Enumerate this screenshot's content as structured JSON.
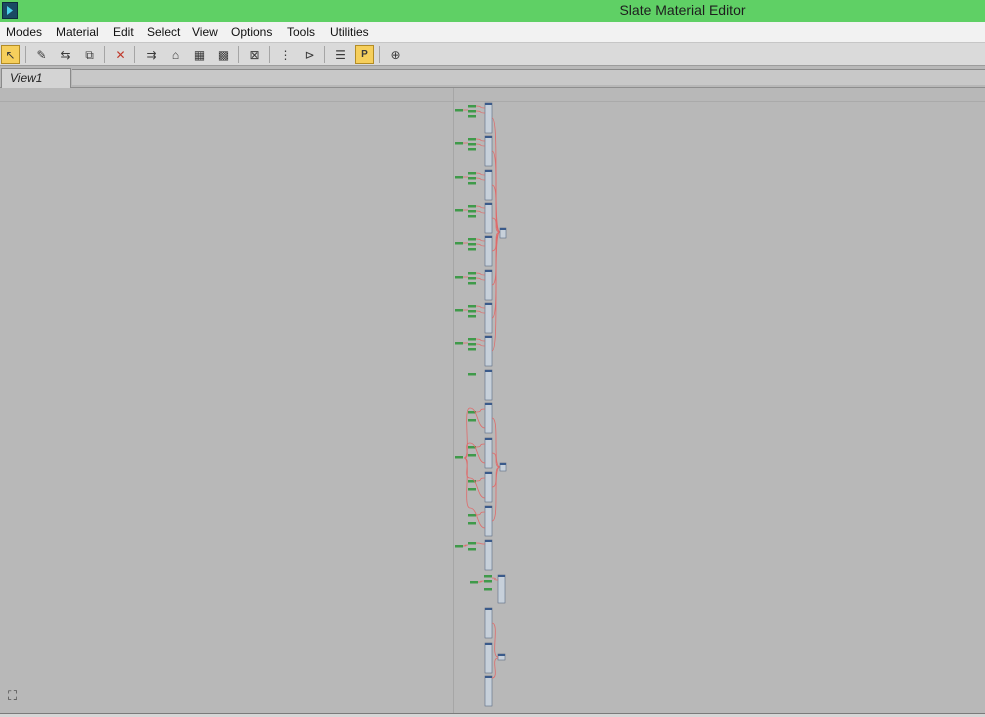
{
  "window": {
    "title": "Slate Material Editor"
  },
  "menubar": {
    "items": [
      "Modes",
      "Material",
      "Edit",
      "Select",
      "View",
      "Options",
      "Tools",
      "Utilities"
    ]
  },
  "toolbar": {
    "tools": [
      {
        "name": "select-tool",
        "icon": "arrow-cursor-icon",
        "glyph": "↖",
        "active": true
      },
      {
        "name": "pick-material-tool",
        "icon": "eyedropper-icon",
        "glyph": "✎",
        "active": false
      },
      {
        "name": "put-to-scene-tool",
        "icon": "put-to-scene-icon",
        "glyph": "⇆",
        "active": false
      },
      {
        "name": "assign-to-selection-tool",
        "icon": "assign-icon",
        "glyph": "⧉",
        "active": false
      },
      {
        "name": "delete-tool",
        "icon": "delete-x-icon",
        "glyph": "✕",
        "active": false
      },
      {
        "name": "move-children-tool",
        "icon": "move-children-icon",
        "glyph": "⇉",
        "active": false
      },
      {
        "name": "hide-unused-slots-tool",
        "icon": "hide-slots-icon",
        "glyph": "⌂",
        "active": false
      },
      {
        "name": "show-shaded-tool",
        "icon": "checker-icon",
        "glyph": "▦",
        "active": false
      },
      {
        "name": "show-realistic-tool",
        "icon": "checker-icon",
        "glyph": "▩",
        "active": false
      },
      {
        "name": "show-end-result-tool",
        "icon": "show-end-result-icon",
        "glyph": "⊠",
        "active": false
      },
      {
        "name": "layout-all-tool",
        "icon": "layout-vertical-icon",
        "glyph": "⋮",
        "active": false
      },
      {
        "name": "layout-children-tool",
        "icon": "layout-children-icon",
        "glyph": "⊳",
        "active": false
      },
      {
        "name": "material-map-browser-tool",
        "icon": "browser-icon",
        "glyph": "☰",
        "active": false
      },
      {
        "name": "parameter-editor-tool",
        "icon": "parameter-editor-icon",
        "glyph": "P",
        "active": true
      },
      {
        "name": "select-by-material-tool",
        "icon": "magnifier-icon",
        "glyph": "⊕",
        "active": false
      }
    ]
  },
  "tabs": [
    {
      "label": "View1",
      "active": true
    }
  ],
  "colors": {
    "titlebar": "#5fd065",
    "canvas": "#b8b8b8",
    "node_body": "#c7d0da",
    "node_border": "#5a6b84",
    "node_header": "#3a5a8a",
    "wire_red": "#e06a6a",
    "map_green": "#3f9a4a"
  },
  "icons": {
    "navigator": "binoculars-icon"
  }
}
